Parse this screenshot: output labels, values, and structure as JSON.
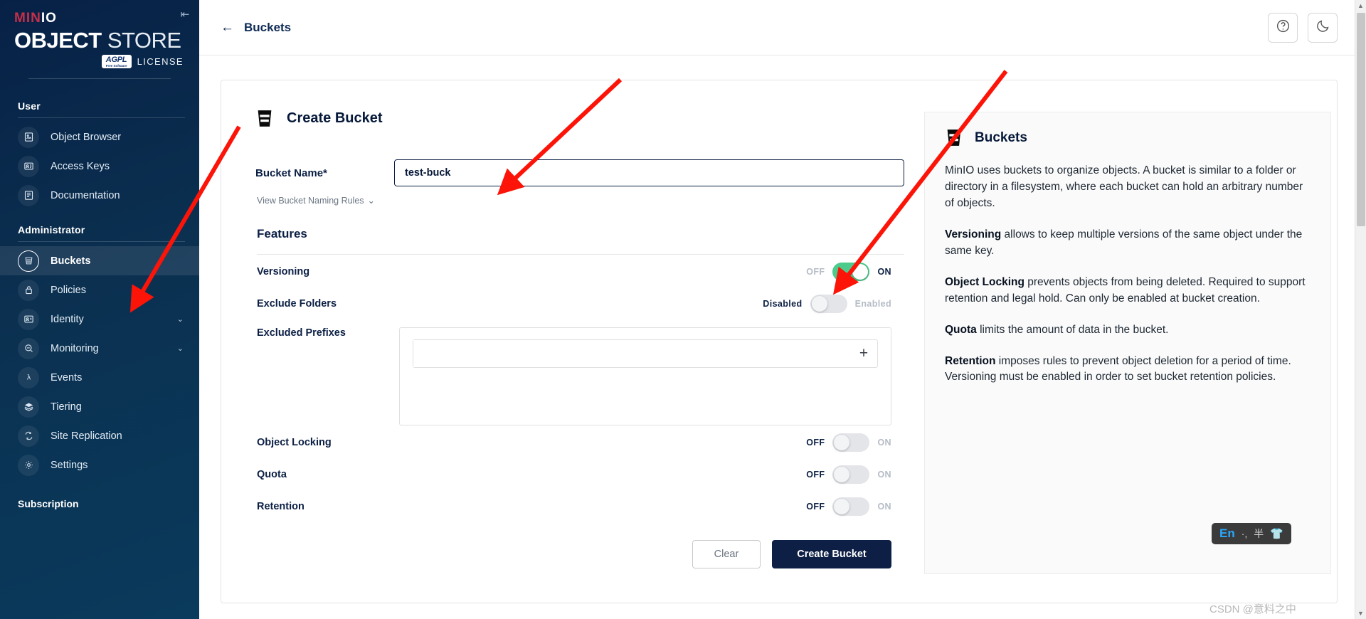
{
  "brand": {
    "minio_min": "MIN",
    "minio_io": "IO",
    "store_obj": "OBJECT",
    "store_store": "STORE",
    "agpl": "AGPL",
    "agpl_sub": "Free Software",
    "license": "LICENSE",
    "collapse_icon": "collapse-left-icon"
  },
  "sidebar": {
    "section_user": "User",
    "section_admin": "Administrator",
    "section_subscription": "Subscription",
    "user_items": [
      {
        "label": "Object Browser",
        "icon": "object-browser-icon"
      },
      {
        "label": "Access Keys",
        "icon": "access-keys-icon"
      },
      {
        "label": "Documentation",
        "icon": "documentation-icon"
      }
    ],
    "admin_items": [
      {
        "label": "Buckets",
        "icon": "bucket-icon",
        "active": true,
        "expandable": false
      },
      {
        "label": "Policies",
        "icon": "lock-icon",
        "active": false,
        "expandable": false
      },
      {
        "label": "Identity",
        "icon": "identity-icon",
        "active": false,
        "expandable": true
      },
      {
        "label": "Monitoring",
        "icon": "monitoring-icon",
        "active": false,
        "expandable": true
      },
      {
        "label": "Events",
        "icon": "lambda-icon",
        "active": false,
        "expandable": false
      },
      {
        "label": "Tiering",
        "icon": "layers-icon",
        "active": false,
        "expandable": false
      },
      {
        "label": "Site Replication",
        "icon": "replication-icon",
        "active": false,
        "expandable": false
      },
      {
        "label": "Settings",
        "icon": "gear-icon",
        "active": false,
        "expandable": false
      }
    ]
  },
  "topbar": {
    "back_icon": "arrow-left-icon",
    "breadcrumb": "Buckets",
    "help_icon": "help-circle-icon",
    "theme_icon": "moon-icon"
  },
  "form": {
    "title": "Create Bucket",
    "title_icon": "bucket-icon",
    "bucket_name_label": "Bucket Name*",
    "bucket_name_value": "test-buck",
    "bucket_name_placeholder": "",
    "naming_rules": "View Bucket Naming Rules",
    "naming_rules_chevron": "chevron-down-icon",
    "features_heading": "Features",
    "toggles": [
      {
        "label": "Versioning",
        "off_text": "OFF",
        "on_text": "ON",
        "state": "on",
        "bold": true
      },
      {
        "label": "Exclude Folders",
        "off_text": "Disabled",
        "on_text": "Enabled",
        "state": "off",
        "bold": true
      }
    ],
    "excluded_prefixes_label": "Excluded Prefixes",
    "excluded_prefixes_value": "",
    "excluded_prefixes_placeholder": "",
    "add_prefix_icon": "plus-icon",
    "bottom_toggles": [
      {
        "label": "Object Locking",
        "off_text": "OFF",
        "on_text": "ON",
        "state": "off"
      },
      {
        "label": "Quota",
        "off_text": "OFF",
        "on_text": "ON",
        "state": "off"
      },
      {
        "label": "Retention",
        "off_text": "OFF",
        "on_text": "ON",
        "state": "off"
      }
    ],
    "clear_button": "Clear",
    "create_button": "Create Bucket"
  },
  "info": {
    "title": "Buckets",
    "title_icon": "bucket-icon",
    "p1": "MinIO uses buckets to organize objects. A bucket is similar to a folder or directory in a filesystem, where each bucket can hold an arbitrary number of objects.",
    "p2_bold": "Versioning",
    "p2": " allows to keep multiple versions of the same object under the same key.",
    "p3_bold": "Object Locking",
    "p3": " prevents objects from being deleted. Required to support retention and legal hold. Can only be enabled at bucket creation.",
    "p4_bold": "Quota",
    "p4": " limits the amount of data in the bucket.",
    "p5_bold": "Retention",
    "p5": " imposes rules to prevent object deletion for a period of time. Versioning must be enabled in order to set bucket retention policies."
  },
  "overlay": {
    "ime_lang": "En",
    "ime_punct": "·,",
    "ime_width": "半",
    "ime_shirt_icon": "shirt-icon",
    "watermark": "CSDN @意料之中"
  },
  "colors": {
    "sidebar_dark": "#072146",
    "accent_navy": "#0d1f45",
    "toggle_on_green": "#4ccb8c",
    "annotation_red": "#fc1408",
    "minio_red": "#c72e49"
  }
}
